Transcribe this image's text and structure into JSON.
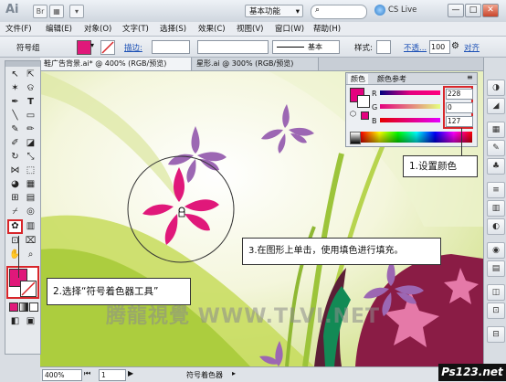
{
  "app": {
    "logo": "Ai",
    "workspace": "基本功能",
    "cs_live": "CS Live"
  },
  "window_buttons": {
    "minimize": "—",
    "maximize": "□",
    "close": "✕"
  },
  "menu": [
    "文件(F)",
    "编辑(E)",
    "对象(O)",
    "文字(T)",
    "选择(S)",
    "效果(C)",
    "视图(V)",
    "窗口(W)",
    "帮助(H)"
  ],
  "control": {
    "selection_label": "符号组",
    "stroke_label": "描边:",
    "basic_label": "基本",
    "style_label": "样式:",
    "opacity_label": "不透...",
    "opacity_value": "100",
    "align_label": "对齐",
    "fill_color": "#e0187a"
  },
  "tabs": [
    {
      "label": "鞋广告背景.ai* @ 400% (RGB/预览)",
      "active": true
    },
    {
      "label": "星形.ai @ 300% (RGB/预览)",
      "active": false
    }
  ],
  "color_panel": {
    "tabs": [
      "颜色",
      "颜色参考"
    ],
    "channels": [
      {
        "label": "R",
        "value": "228"
      },
      {
        "label": "G",
        "value": "0"
      },
      {
        "label": "B",
        "value": "127"
      }
    ],
    "current_color": "#e4007f"
  },
  "callouts": {
    "set_color": "1.设置颜色",
    "select_tool": "2.选择“符号着色器工具”",
    "click_fill": "3.在图形上单击，使用填色进行填充。"
  },
  "status": {
    "zoom": "400%",
    "page": "1",
    "tool": "符号着色器"
  },
  "watermark": {
    "text": "腾龍視覺 WWW.TLVI.NET",
    "badge": "Ps123.net"
  },
  "colors": {
    "fill": "#e0187a",
    "accent_red": "#d8262a",
    "purple_flower": "#9c67b3"
  }
}
